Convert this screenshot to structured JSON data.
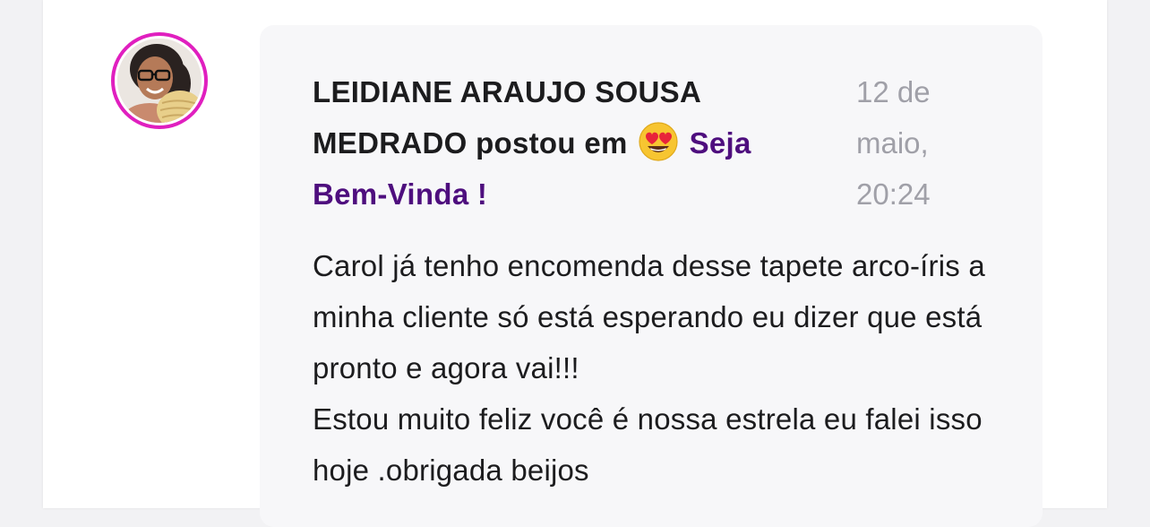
{
  "post": {
    "author": "LEIDIANE ARAUJO SOUSA MEDRADO",
    "verb": "postou em",
    "channel_emoji": "heart-eyes-emoji",
    "channel": "Seja Bem-Vinda !",
    "timestamp": "12 de maio, 20:24",
    "body": "Carol já tenho encomenda desse tapete arco-íris a minha cliente só está esperando eu dizer que está pronto e agora vai!!!\nEstou muito feliz você é nossa estrela eu falei isso hoje .obrigada beijos"
  },
  "colors": {
    "avatar_ring": "#e01fbf",
    "channel_link": "#4e0e7e",
    "timestamp": "#a0a0a8",
    "card_bg": "#f7f7f9"
  }
}
